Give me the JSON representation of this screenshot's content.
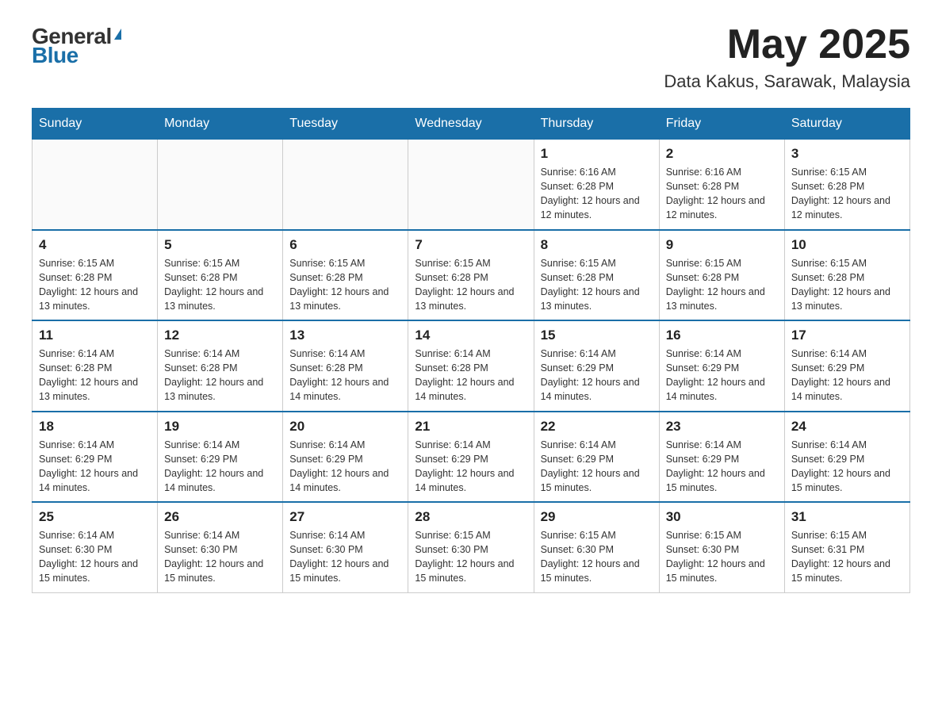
{
  "header": {
    "logo_general": "General",
    "logo_blue": "Blue",
    "month_year": "May 2025",
    "location": "Data Kakus, Sarawak, Malaysia"
  },
  "days_of_week": [
    "Sunday",
    "Monday",
    "Tuesday",
    "Wednesday",
    "Thursday",
    "Friday",
    "Saturday"
  ],
  "weeks": [
    [
      {
        "day": "",
        "info": ""
      },
      {
        "day": "",
        "info": ""
      },
      {
        "day": "",
        "info": ""
      },
      {
        "day": "",
        "info": ""
      },
      {
        "day": "1",
        "info": "Sunrise: 6:16 AM\nSunset: 6:28 PM\nDaylight: 12 hours and 12 minutes."
      },
      {
        "day": "2",
        "info": "Sunrise: 6:16 AM\nSunset: 6:28 PM\nDaylight: 12 hours and 12 minutes."
      },
      {
        "day": "3",
        "info": "Sunrise: 6:15 AM\nSunset: 6:28 PM\nDaylight: 12 hours and 12 minutes."
      }
    ],
    [
      {
        "day": "4",
        "info": "Sunrise: 6:15 AM\nSunset: 6:28 PM\nDaylight: 12 hours and 13 minutes."
      },
      {
        "day": "5",
        "info": "Sunrise: 6:15 AM\nSunset: 6:28 PM\nDaylight: 12 hours and 13 minutes."
      },
      {
        "day": "6",
        "info": "Sunrise: 6:15 AM\nSunset: 6:28 PM\nDaylight: 12 hours and 13 minutes."
      },
      {
        "day": "7",
        "info": "Sunrise: 6:15 AM\nSunset: 6:28 PM\nDaylight: 12 hours and 13 minutes."
      },
      {
        "day": "8",
        "info": "Sunrise: 6:15 AM\nSunset: 6:28 PM\nDaylight: 12 hours and 13 minutes."
      },
      {
        "day": "9",
        "info": "Sunrise: 6:15 AM\nSunset: 6:28 PM\nDaylight: 12 hours and 13 minutes."
      },
      {
        "day": "10",
        "info": "Sunrise: 6:15 AM\nSunset: 6:28 PM\nDaylight: 12 hours and 13 minutes."
      }
    ],
    [
      {
        "day": "11",
        "info": "Sunrise: 6:14 AM\nSunset: 6:28 PM\nDaylight: 12 hours and 13 minutes."
      },
      {
        "day": "12",
        "info": "Sunrise: 6:14 AM\nSunset: 6:28 PM\nDaylight: 12 hours and 13 minutes."
      },
      {
        "day": "13",
        "info": "Sunrise: 6:14 AM\nSunset: 6:28 PM\nDaylight: 12 hours and 14 minutes."
      },
      {
        "day": "14",
        "info": "Sunrise: 6:14 AM\nSunset: 6:28 PM\nDaylight: 12 hours and 14 minutes."
      },
      {
        "day": "15",
        "info": "Sunrise: 6:14 AM\nSunset: 6:29 PM\nDaylight: 12 hours and 14 minutes."
      },
      {
        "day": "16",
        "info": "Sunrise: 6:14 AM\nSunset: 6:29 PM\nDaylight: 12 hours and 14 minutes."
      },
      {
        "day": "17",
        "info": "Sunrise: 6:14 AM\nSunset: 6:29 PM\nDaylight: 12 hours and 14 minutes."
      }
    ],
    [
      {
        "day": "18",
        "info": "Sunrise: 6:14 AM\nSunset: 6:29 PM\nDaylight: 12 hours and 14 minutes."
      },
      {
        "day": "19",
        "info": "Sunrise: 6:14 AM\nSunset: 6:29 PM\nDaylight: 12 hours and 14 minutes."
      },
      {
        "day": "20",
        "info": "Sunrise: 6:14 AM\nSunset: 6:29 PM\nDaylight: 12 hours and 14 minutes."
      },
      {
        "day": "21",
        "info": "Sunrise: 6:14 AM\nSunset: 6:29 PM\nDaylight: 12 hours and 14 minutes."
      },
      {
        "day": "22",
        "info": "Sunrise: 6:14 AM\nSunset: 6:29 PM\nDaylight: 12 hours and 15 minutes."
      },
      {
        "day": "23",
        "info": "Sunrise: 6:14 AM\nSunset: 6:29 PM\nDaylight: 12 hours and 15 minutes."
      },
      {
        "day": "24",
        "info": "Sunrise: 6:14 AM\nSunset: 6:29 PM\nDaylight: 12 hours and 15 minutes."
      }
    ],
    [
      {
        "day": "25",
        "info": "Sunrise: 6:14 AM\nSunset: 6:30 PM\nDaylight: 12 hours and 15 minutes."
      },
      {
        "day": "26",
        "info": "Sunrise: 6:14 AM\nSunset: 6:30 PM\nDaylight: 12 hours and 15 minutes."
      },
      {
        "day": "27",
        "info": "Sunrise: 6:14 AM\nSunset: 6:30 PM\nDaylight: 12 hours and 15 minutes."
      },
      {
        "day": "28",
        "info": "Sunrise: 6:15 AM\nSunset: 6:30 PM\nDaylight: 12 hours and 15 minutes."
      },
      {
        "day": "29",
        "info": "Sunrise: 6:15 AM\nSunset: 6:30 PM\nDaylight: 12 hours and 15 minutes."
      },
      {
        "day": "30",
        "info": "Sunrise: 6:15 AM\nSunset: 6:30 PM\nDaylight: 12 hours and 15 minutes."
      },
      {
        "day": "31",
        "info": "Sunrise: 6:15 AM\nSunset: 6:31 PM\nDaylight: 12 hours and 15 minutes."
      }
    ]
  ]
}
